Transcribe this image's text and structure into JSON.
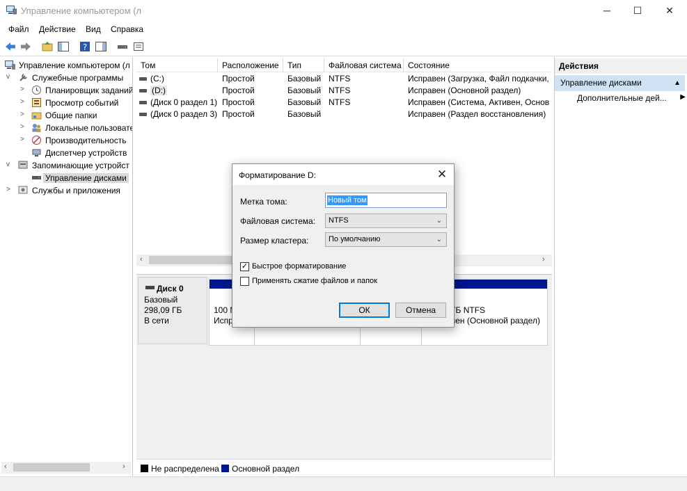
{
  "window": {
    "title": "Управление компьютером (л"
  },
  "menu": [
    "Файл",
    "Действие",
    "Вид",
    "Справка"
  ],
  "tree": {
    "items": [
      {
        "label": "Управление компьютером (л",
        "level": 0,
        "expander": ""
      },
      {
        "label": "Служебные программы",
        "level": 1,
        "expander": "v"
      },
      {
        "label": "Планировщик заданий",
        "level": 2,
        "expander": ">"
      },
      {
        "label": "Просмотр событий",
        "level": 2,
        "expander": ">"
      },
      {
        "label": "Общие папки",
        "level": 2,
        "expander": ">"
      },
      {
        "label": "Локальные пользовате",
        "level": 2,
        "expander": ">"
      },
      {
        "label": "Производительность",
        "level": 2,
        "expander": ">"
      },
      {
        "label": "Диспетчер устройств",
        "level": 2,
        "expander": ""
      },
      {
        "label": "Запоминающие устройст",
        "level": 1,
        "expander": "v"
      },
      {
        "label": "Управление дисками",
        "level": 2,
        "expander": ""
      },
      {
        "label": "Службы и приложения",
        "level": 1,
        "expander": ">"
      }
    ]
  },
  "volumes": {
    "columns": [
      "Том",
      "Расположение",
      "Тип",
      "Файловая система",
      "Состояние"
    ],
    "rows": [
      [
        "(C:)",
        "Простой",
        "Базовый",
        "NTFS",
        "Исправен (Загрузка, Файл подкачки,"
      ],
      [
        "(D:)",
        "Простой",
        "Базовый",
        "NTFS",
        "Исправен (Основной раздел)"
      ],
      [
        "(Диск 0 раздел 1)",
        "Простой",
        "Базовый",
        "NTFS",
        "Исправен (Система, Активен, Основ"
      ],
      [
        "(Диск 0 раздел 3)",
        "Простой",
        "Базовый",
        "",
        "Исправен (Раздел восстановления)"
      ]
    ]
  },
  "disk": {
    "name": "Диск 0",
    "type": "Базовый",
    "size": "298,09 ГБ",
    "state": "В сети",
    "part1_line1": "100 М",
    "part1_line2": "Испр",
    "part_right_line1": "ГБ NTFS",
    "part_right_line2": "вен (Основной раздел)"
  },
  "legend": {
    "unallocated": "Не распределена",
    "primary": "Основной раздел",
    "unallocated_color": "#000000",
    "primary_color": "#00168c"
  },
  "actions": {
    "header": "Действия",
    "section": "Управление дисками",
    "more": "Дополнительные дей..."
  },
  "dialog": {
    "title": "Форматирование D:",
    "label_volume": "Метка тома:",
    "volume_value": "Новый том",
    "label_fs": "Файловая система:",
    "fs_value": "NTFS",
    "label_cluster": "Размер кластера:",
    "cluster_value": "По умолчанию",
    "quick_format": "Быстрое форматирование",
    "quick_format_checked": true,
    "compress": "Применять сжатие файлов и папок",
    "compress_checked": false,
    "ok": "ОК",
    "cancel": "Отмена"
  },
  "icons": {
    "app": "computer-management-icon",
    "back": "back-arrow-icon",
    "forward": "forward-arrow-icon"
  },
  "colors": {
    "accent": "#0078d7",
    "selection": "#3399ff",
    "action_section": "#cfe3f5"
  }
}
